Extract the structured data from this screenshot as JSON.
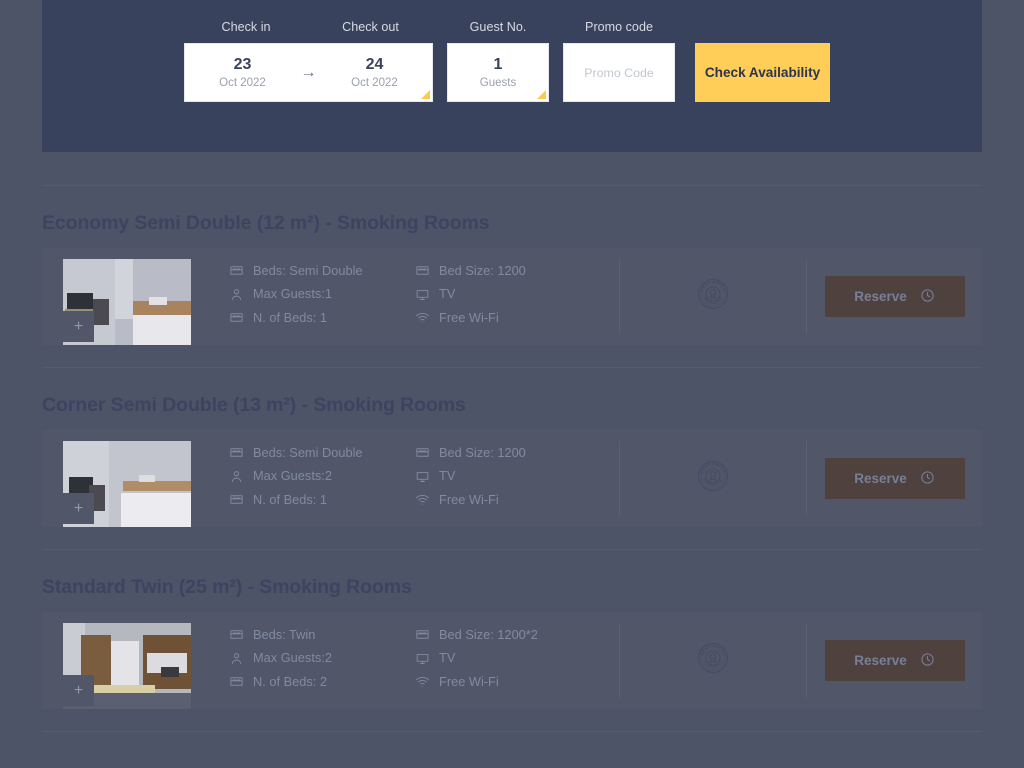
{
  "booking_bar": {
    "checkin": {
      "label": "Check in",
      "day": "23",
      "month_year": "Oct 2022"
    },
    "arrow": "→",
    "checkout": {
      "label": "Check out",
      "day": "24",
      "month_year": "Oct 2022"
    },
    "guests": {
      "label": "Guest No.",
      "count": "1",
      "unit": "Guests"
    },
    "promo": {
      "label": "Promo code",
      "value": "",
      "placeholder": "Promo Code"
    },
    "check_availability_label": "Check Availability",
    "accent_color": "#ffce58",
    "panel_color": "#39425c"
  },
  "rooms": [
    {
      "title": "Economy Semi Double (12 m²) - Smoking Rooms",
      "thumb_plus": "+",
      "amenities_col1": [
        {
          "icon": "bed-icon",
          "text": "Beds: Semi Double"
        },
        {
          "icon": "person-icon",
          "text": "Max Guests:1"
        },
        {
          "icon": "bed-icon",
          "text": "N. of Beds: 1"
        }
      ],
      "amenities_col2": [
        {
          "icon": "bed-icon",
          "text": "Bed Size: 1200"
        },
        {
          "icon": "tv-icon",
          "text": "TV"
        },
        {
          "icon": "wifi-icon",
          "text": "Free Wi-Fi"
        }
      ],
      "badge": {
        "icon": "best-price-guarantee-badge",
        "top_text": "BEST PRICE",
        "bottom_text": "GUARANTEE"
      },
      "reserve_label": "Reserve"
    },
    {
      "title": "Corner Semi Double (13 m²) - Smoking Rooms",
      "thumb_plus": "+",
      "amenities_col1": [
        {
          "icon": "bed-icon",
          "text": "Beds: Semi Double"
        },
        {
          "icon": "person-icon",
          "text": "Max Guests:2"
        },
        {
          "icon": "bed-icon",
          "text": "N. of Beds: 1"
        }
      ],
      "amenities_col2": [
        {
          "icon": "bed-icon",
          "text": "Bed Size: 1200"
        },
        {
          "icon": "tv-icon",
          "text": "TV"
        },
        {
          "icon": "wifi-icon",
          "text": "Free Wi-Fi"
        }
      ],
      "badge": {
        "icon": "best-price-guarantee-badge",
        "top_text": "BEST PRICE",
        "bottom_text": "GUARANTEE"
      },
      "reserve_label": "Reserve"
    },
    {
      "title": "Standard Twin (25 m²) - Smoking Rooms",
      "thumb_plus": "+",
      "amenities_col1": [
        {
          "icon": "bed-icon",
          "text": "Beds: Twin"
        },
        {
          "icon": "person-icon",
          "text": "Max Guests:2"
        },
        {
          "icon": "bed-icon",
          "text": "N. of Beds: 2"
        }
      ],
      "amenities_col2": [
        {
          "icon": "bed-icon",
          "text": "Bed Size: 1200*2"
        },
        {
          "icon": "tv-icon",
          "text": "TV"
        },
        {
          "icon": "wifi-icon",
          "text": "Free Wi-Fi"
        }
      ],
      "badge": {
        "icon": "best-price-guarantee-badge",
        "top_text": "BEST PRICE",
        "bottom_text": "GUARANTEE"
      },
      "reserve_label": "Reserve"
    }
  ],
  "theme": {
    "overlay_color": "#4e5467",
    "card_color": "#515769",
    "title_color": "#3b4460",
    "muted_text_color": "#818aa0",
    "reserve_button_color": "#4f413e"
  }
}
